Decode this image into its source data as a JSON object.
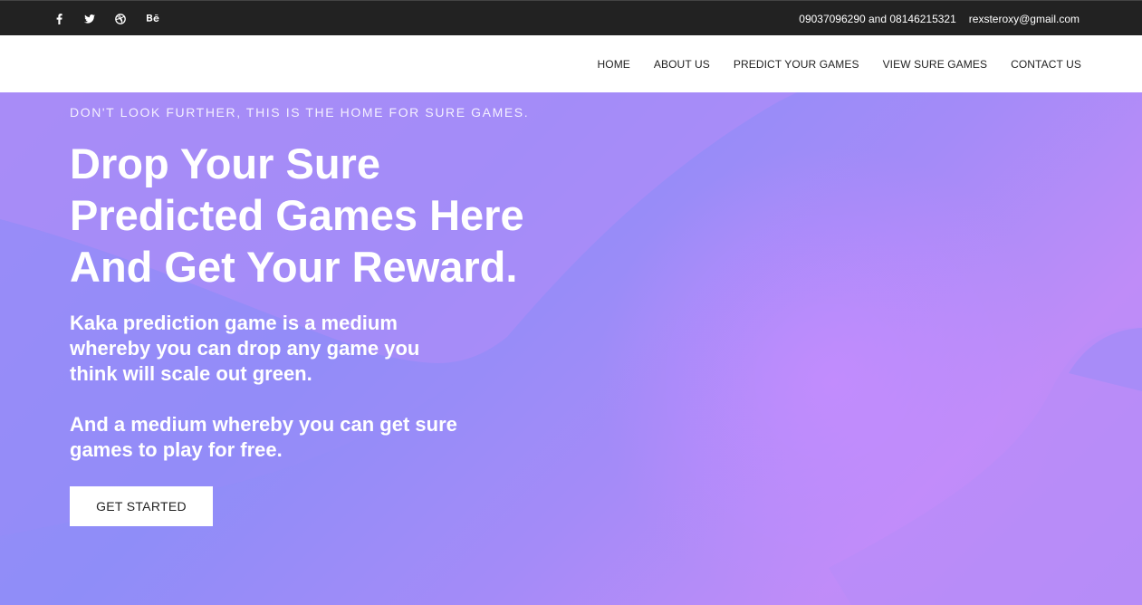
{
  "topbar": {
    "social": [
      {
        "name": "facebook-icon",
        "glyph": "f"
      },
      {
        "name": "twitter-icon",
        "glyph": "t"
      },
      {
        "name": "dribbble-icon",
        "glyph": "d"
      },
      {
        "name": "behance-icon",
        "glyph": "Bē"
      }
    ],
    "phones": "09037096290 and 08146215321",
    "email": "rexsteroxy@gmail.com"
  },
  "nav": {
    "items": [
      "HOME",
      "ABOUT US",
      "PREDICT YOUR GAMES",
      "VIEW SURE GAMES",
      "CONTACT US"
    ]
  },
  "hero": {
    "eyebrow": "DON'T LOOK FURTHER, THIS IS THE HOME FOR SURE GAMES.",
    "headline": "Drop Your Sure Predicted Games Here And Get Your Reward.",
    "description_1": "Kaka prediction game is a medium whereby you can drop any game you think will scale out green.",
    "description_2": "And a medium whereby you can get sure games to play for free.",
    "cta_label": "GET STARTED"
  },
  "colors": {
    "topbar_bg": "#222222",
    "hero_gradient_start": "#8f8df8",
    "hero_gradient_end": "#bf8cf8",
    "cta_bg": "#ffffff"
  }
}
